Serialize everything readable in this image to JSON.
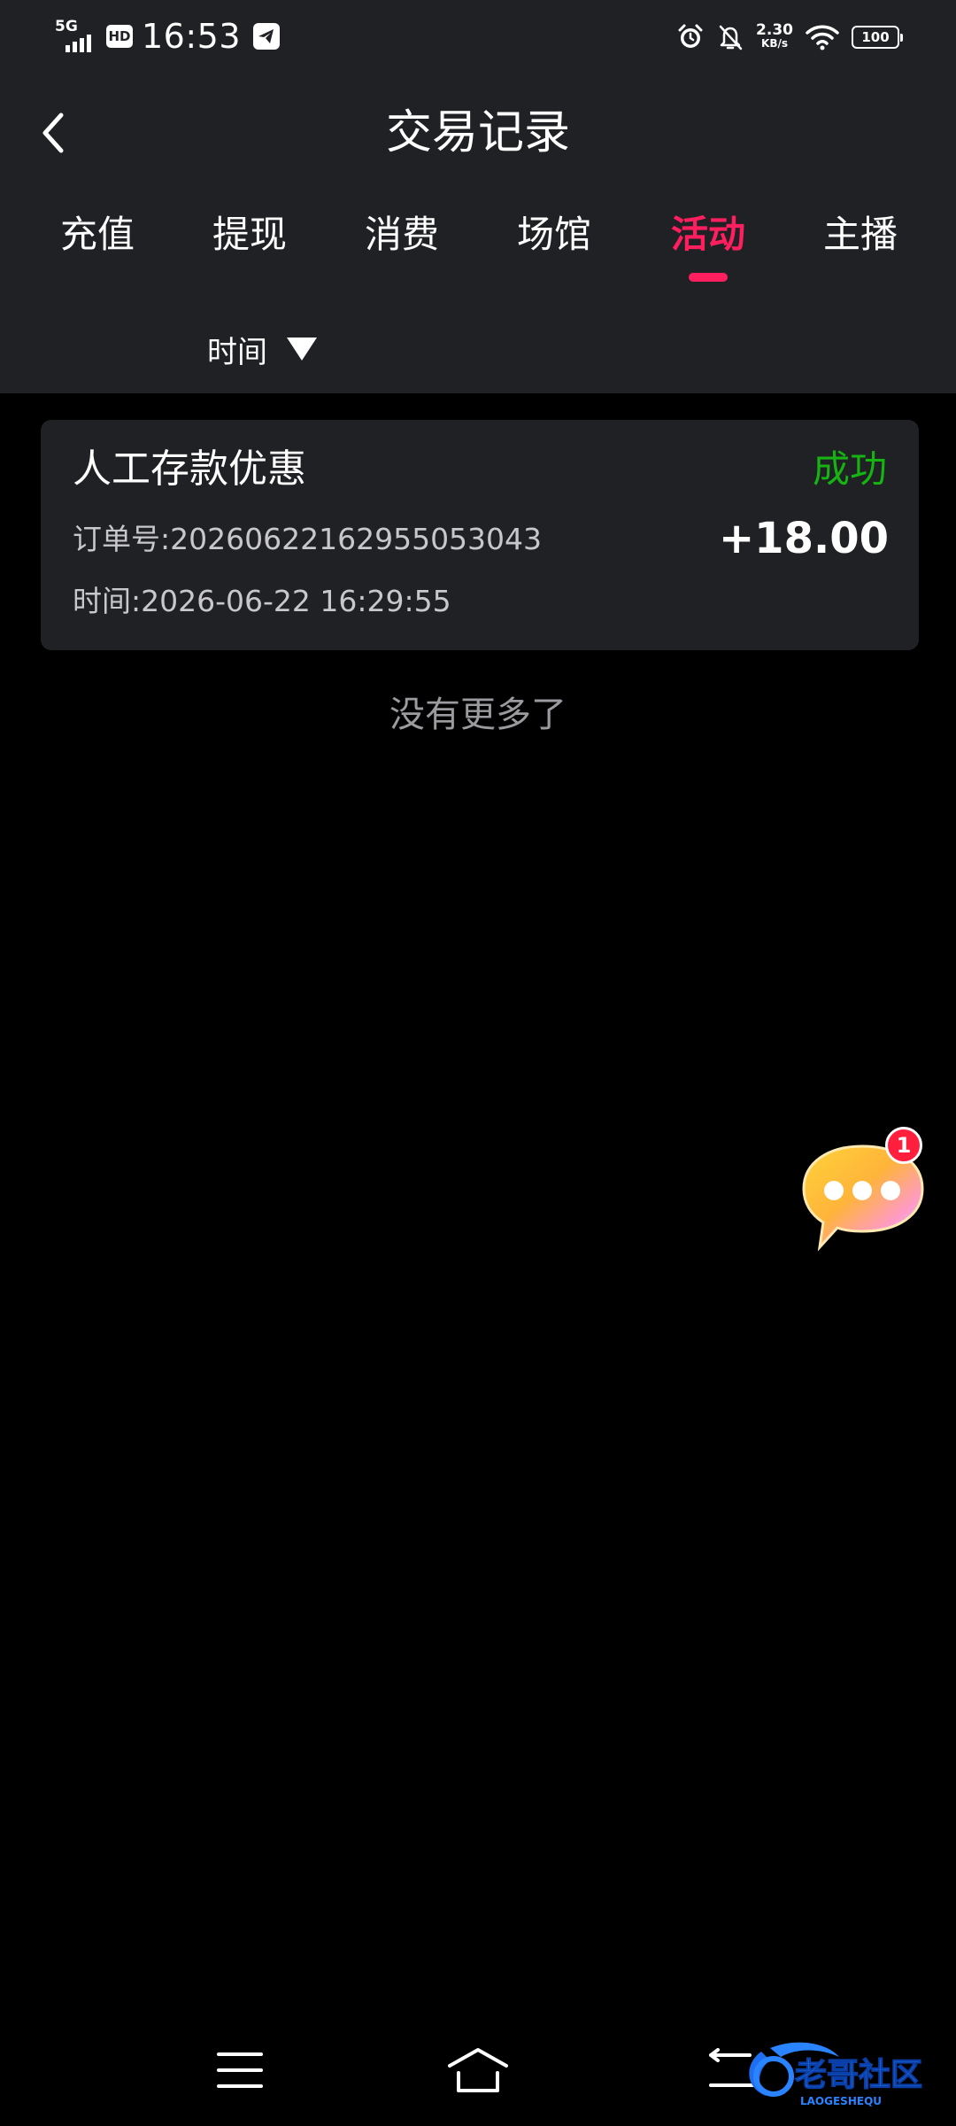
{
  "status_bar": {
    "network": "5G",
    "hd": "HD",
    "time": "16:53",
    "speed_value": "2.30",
    "speed_unit": "KB/s",
    "battery": "100",
    "icons": [
      "signal-icon",
      "hd-icon",
      "telegram-icon",
      "alarm-icon",
      "mute-bell-icon",
      "wifi-icon",
      "battery-icon"
    ]
  },
  "header": {
    "title": "交易记录"
  },
  "tabs": [
    {
      "label": "充值",
      "active": false
    },
    {
      "label": "提现",
      "active": false
    },
    {
      "label": "消费",
      "active": false
    },
    {
      "label": "场馆",
      "active": false
    },
    {
      "label": "活动",
      "active": true
    },
    {
      "label": "主播",
      "active": false
    }
  ],
  "filter": {
    "label": "时间"
  },
  "records": [
    {
      "name": "人工存款优惠",
      "status": "成功",
      "order_label": "订单号:",
      "order_no": "20260622162955053043",
      "amount": "+18.00",
      "time_label": "时间:",
      "time": "2026-06-22 16:29:55"
    }
  ],
  "list_footer": "没有更多了",
  "chat_fab": {
    "badge": "1"
  },
  "watermark": {
    "text": "老哥社区",
    "sub": "LAOGESHEQU"
  },
  "colors": {
    "header_bg": "#202125",
    "page_bg": "#000000",
    "accent": "#ff1f5e",
    "success": "#16b313",
    "muted_text": "#c8c8cc"
  }
}
